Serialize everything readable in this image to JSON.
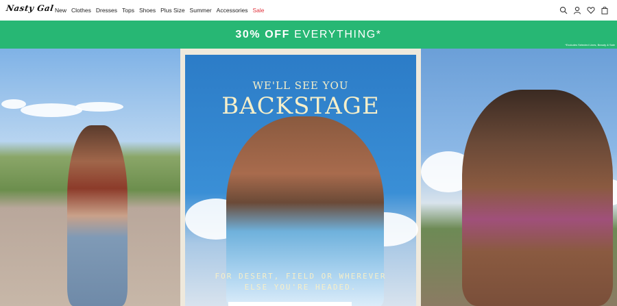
{
  "brand": {
    "logo_text": "Nasty Gal"
  },
  "nav": {
    "items": [
      {
        "label": "New"
      },
      {
        "label": "Clothes"
      },
      {
        "label": "Dresses"
      },
      {
        "label": "Tops"
      },
      {
        "label": "Shoes"
      },
      {
        "label": "Plus Size"
      },
      {
        "label": "Summer"
      },
      {
        "label": "Accessories"
      },
      {
        "label": "Sale"
      }
    ],
    "icons": [
      "search-icon",
      "account-icon",
      "wishlist-heart-icon",
      "bag-icon"
    ]
  },
  "promo": {
    "bold": "30% OFF",
    "rest": "EVERYTHING*",
    "fine_print": "*Excludes Selected Lines, Beauty & Sale",
    "color": "#27b774"
  },
  "hero": {
    "middle": {
      "headline_small": "WE'LL SEE YOU",
      "headline_big": "BACKSTAGE",
      "sub_line1": "FOR DESERT, FIELD OR WHEREVER",
      "sub_line2": "ELSE YOU'RE HEADED."
    }
  }
}
